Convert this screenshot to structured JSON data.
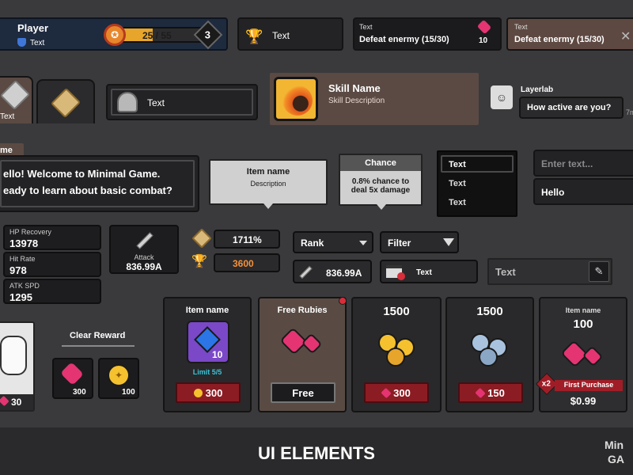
{
  "player": {
    "name": "Player",
    "tag": "Text",
    "xp": "25 / 55",
    "level": "3"
  },
  "trophy_text": "Text",
  "quest_1": {
    "label": "Text",
    "desc": "Defeat enermy (15/30)",
    "reward": "10"
  },
  "quest_2": {
    "label": "Text",
    "desc": "Defeat enermy (15/30)"
  },
  "tab_1_label": "Text",
  "helmet_item_label": "Text",
  "skill": {
    "name": "Skill Name",
    "desc": "Skill Description"
  },
  "chat": {
    "name": "Layerlab",
    "message": "How active are you?",
    "time": "7m"
  },
  "dialog": {
    "speaker": "me",
    "line1": "ello! Welcome to Minimal Game.",
    "line2": "eady to learn about basic combat?"
  },
  "tooltip_item": {
    "name": "Item name",
    "desc": "Description"
  },
  "tooltip_chance": {
    "title": "Chance",
    "line1": "0.8% chance to",
    "line2": "deal 5x damage"
  },
  "dropdown_list": [
    "Text",
    "Text",
    "Text"
  ],
  "input_placeholder": "Enter text...",
  "input_value": "Hello",
  "stats": [
    {
      "label": "HP Recovery",
      "value": "13978"
    },
    {
      "label": "Hit Rate",
      "value": "978"
    },
    {
      "label": "ATK SPD",
      "value": "1295"
    }
  ],
  "attack": {
    "label": "Attack",
    "value": "836.99A"
  },
  "stat_pills": [
    {
      "value": "1711%"
    },
    {
      "value": "3600"
    }
  ],
  "rank_select": "Rank",
  "filter_label": "Filter",
  "attack_small_value": "836.99A",
  "video_text": "Text",
  "edit_text": "Text",
  "character_count": "30",
  "clear_reward": {
    "title": "Clear Reward",
    "items": [
      "300",
      "100"
    ]
  },
  "shop": [
    {
      "title": "Item name",
      "amount": "10",
      "limit": "Limit 5/5",
      "price": "300"
    },
    {
      "title": "Free Rubies",
      "button": "Free"
    },
    {
      "title": "1500",
      "price": "300"
    },
    {
      "title": "1500",
      "price": "150"
    },
    {
      "title": "Item name",
      "amount": "100",
      "multiplier": "x2",
      "banner": "First Purchase",
      "price": "$0.99"
    }
  ],
  "footer_title": "UI ELEMENTS",
  "corner_logo": [
    "Min",
    "GA"
  ]
}
